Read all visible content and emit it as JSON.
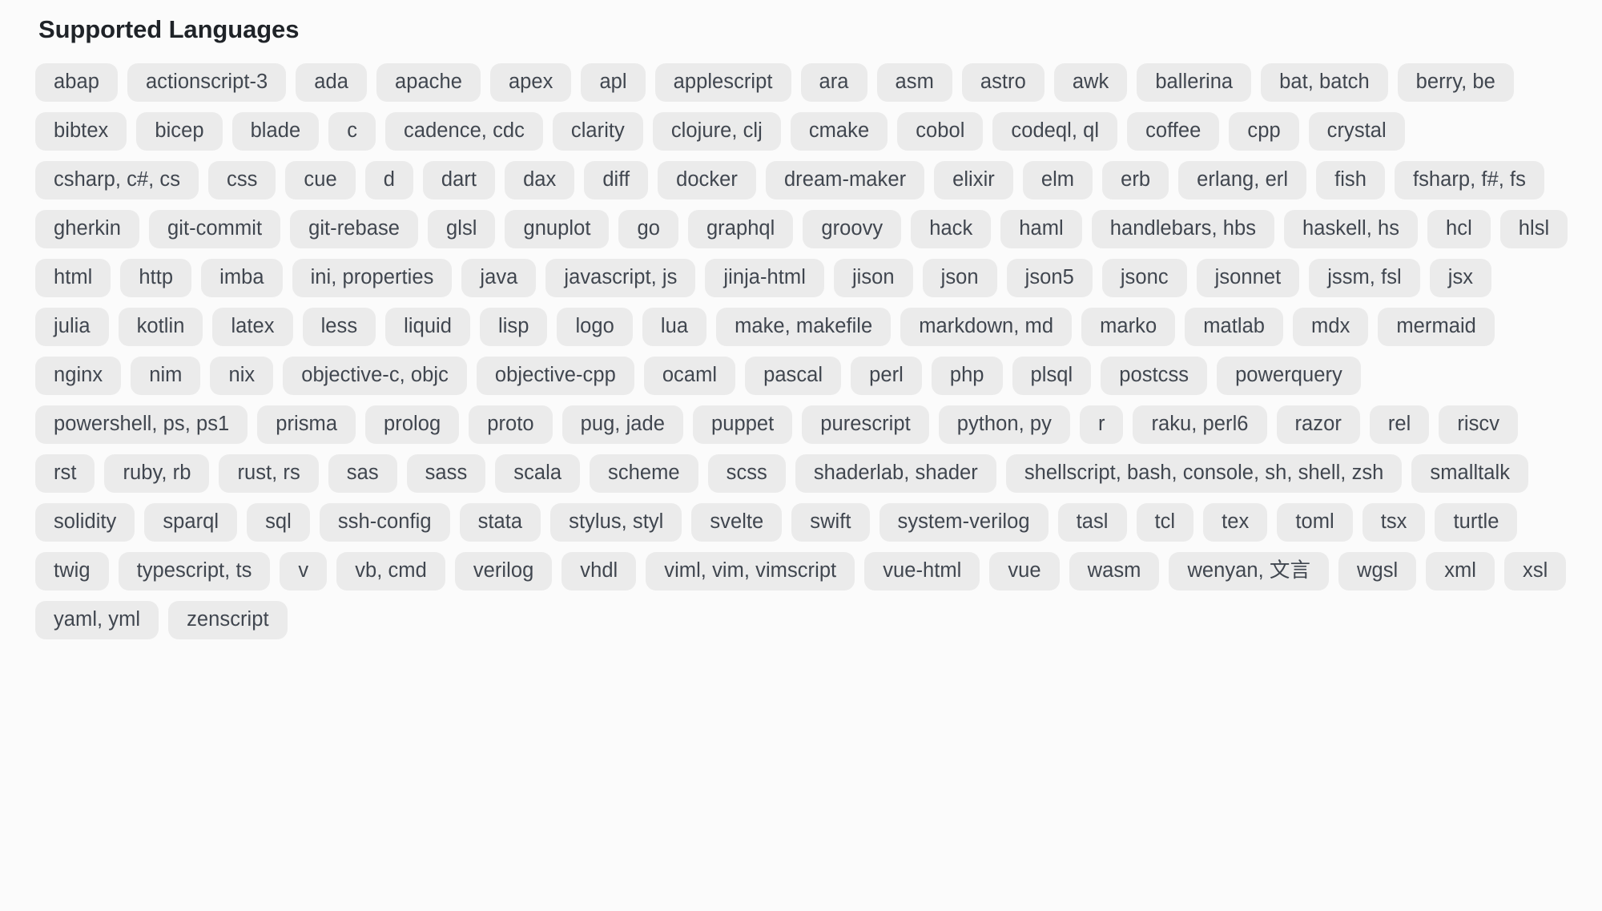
{
  "section": {
    "title": "Supported Languages"
  },
  "languages": [
    "abap",
    "actionscript-3",
    "ada",
    "apache",
    "apex",
    "apl",
    "applescript",
    "ara",
    "asm",
    "astro",
    "awk",
    "ballerina",
    "bat, batch",
    "berry, be",
    "bibtex",
    "bicep",
    "blade",
    "c",
    "cadence, cdc",
    "clarity",
    "clojure, clj",
    "cmake",
    "cobol",
    "codeql, ql",
    "coffee",
    "cpp",
    "crystal",
    "csharp, c#, cs",
    "css",
    "cue",
    "d",
    "dart",
    "dax",
    "diff",
    "docker",
    "dream-maker",
    "elixir",
    "elm",
    "erb",
    "erlang, erl",
    "fish",
    "fsharp, f#, fs",
    "gherkin",
    "git-commit",
    "git-rebase",
    "glsl",
    "gnuplot",
    "go",
    "graphql",
    "groovy",
    "hack",
    "haml",
    "handlebars, hbs",
    "haskell, hs",
    "hcl",
    "hlsl",
    "html",
    "http",
    "imba",
    "ini, properties",
    "java",
    "javascript, js",
    "jinja-html",
    "jison",
    "json",
    "json5",
    "jsonc",
    "jsonnet",
    "jssm, fsl",
    "jsx",
    "julia",
    "kotlin",
    "latex",
    "less",
    "liquid",
    "lisp",
    "logo",
    "lua",
    "make, makefile",
    "markdown, md",
    "marko",
    "matlab",
    "mdx",
    "mermaid",
    "nginx",
    "nim",
    "nix",
    "objective-c, objc",
    "objective-cpp",
    "ocaml",
    "pascal",
    "perl",
    "php",
    "plsql",
    "postcss",
    "powerquery",
    "powershell, ps, ps1",
    "prisma",
    "prolog",
    "proto",
    "pug, jade",
    "puppet",
    "purescript",
    "python, py",
    "r",
    "raku, perl6",
    "razor",
    "rel",
    "riscv",
    "rst",
    "ruby, rb",
    "rust, rs",
    "sas",
    "sass",
    "scala",
    "scheme",
    "scss",
    "shaderlab, shader",
    "shellscript, bash, console, sh, shell, zsh",
    "smalltalk",
    "solidity",
    "sparql",
    "sql",
    "ssh-config",
    "stata",
    "stylus, styl",
    "svelte",
    "swift",
    "system-verilog",
    "tasl",
    "tcl",
    "tex",
    "toml",
    "tsx",
    "turtle",
    "twig",
    "typescript, ts",
    "v",
    "vb, cmd",
    "verilog",
    "vhdl",
    "viml, vim, vimscript",
    "vue-html",
    "vue",
    "wasm",
    "wenyan, 文言",
    "wgsl",
    "xml",
    "xsl",
    "yaml, yml",
    "zenscript"
  ],
  "colors": {
    "page_background": "#fbfbfb",
    "tag_background": "#ebebeb",
    "tag_text": "#40464f",
    "title_text": "#1f2328"
  }
}
